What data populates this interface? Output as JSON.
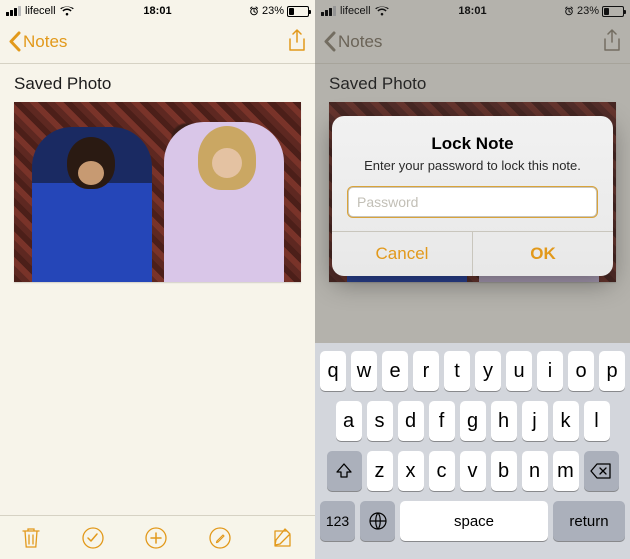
{
  "status": {
    "carrier": "lifecell",
    "time": "18:01",
    "battery_pct": "23%"
  },
  "nav": {
    "back_label": "Notes"
  },
  "note": {
    "title": "Saved Photo"
  },
  "alert": {
    "title": "Lock Note",
    "message": "Enter your password to lock this note.",
    "placeholder": "Password",
    "cancel": "Cancel",
    "ok": "OK"
  },
  "keyboard": {
    "row1": [
      "q",
      "w",
      "e",
      "r",
      "t",
      "y",
      "u",
      "i",
      "o",
      "p"
    ],
    "row2": [
      "a",
      "s",
      "d",
      "f",
      "g",
      "h",
      "j",
      "k",
      "l"
    ],
    "row3": [
      "z",
      "x",
      "c",
      "v",
      "b",
      "n",
      "m"
    ],
    "num_label": "123",
    "space_label": "space",
    "return_label": "return"
  },
  "colors": {
    "accent": "#e2991b"
  }
}
